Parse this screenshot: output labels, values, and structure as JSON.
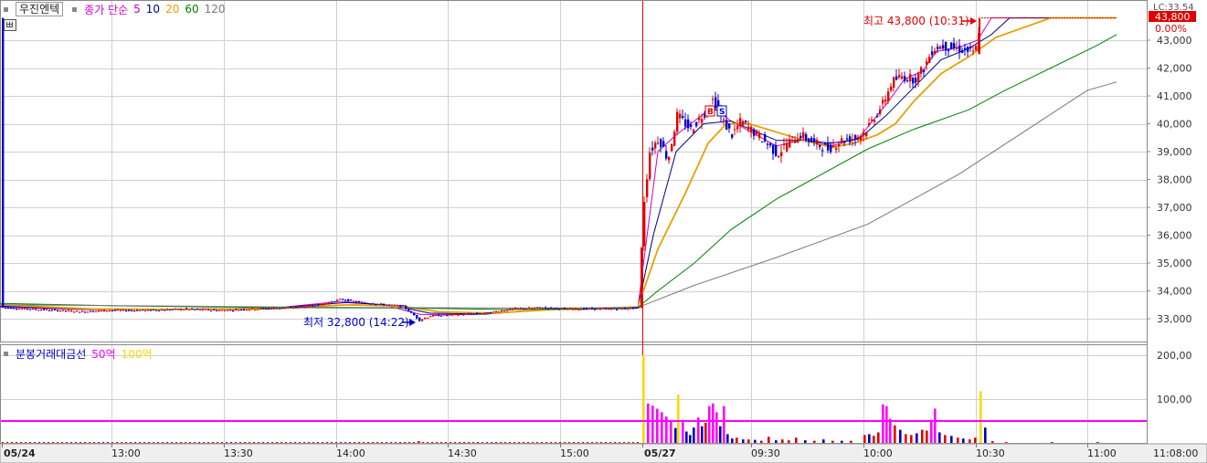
{
  "legend": {
    "stock_name": "우진엔텍",
    "ma_label": "종가 단순",
    "ma_periods": [
      {
        "label": "5",
        "color": "#cc00cc"
      },
      {
        "label": "10",
        "color": "#000080"
      },
      {
        "label": "20",
        "color": "#e8a000"
      },
      {
        "label": "60",
        "color": "#008000"
      },
      {
        "label": "120",
        "color": "#777777"
      }
    ]
  },
  "volume_legend": {
    "title": "분봉거래대금선",
    "line1": {
      "label": "50억",
      "color": "#ff00ff"
    },
    "line2": {
      "label": "100억",
      "color": "#ffd700"
    }
  },
  "price_panel": {
    "top_right_label": "LC:33.54",
    "last_price_badge": "43,800",
    "change_pct": "0.00%",
    "high_annotation": "최고 43,800 (10:31)",
    "low_annotation": "최저 32,800 (14:22)"
  },
  "time_axis": {
    "labels": [
      "05/24",
      "13:00",
      "13:30",
      "14:00",
      "14:30",
      "15:00",
      "05/27",
      "09:30",
      "10:00",
      "10:30",
      "11:00"
    ],
    "clock": "11:08:00"
  },
  "colors": {
    "up": "#e00000",
    "down": "#0000c8",
    "day_divider": "#e00000",
    "grid": "#d0d0d0",
    "badge_bg": "#e00000"
  },
  "chart_data": [
    {
      "type": "candlestick",
      "title": "우진엔텍",
      "ylim": [
        32500,
        44000
      ],
      "y_ticks": [
        "33,000",
        "34,000",
        "35,000",
        "36,000",
        "37,000",
        "38,000",
        "39,000",
        "40,000",
        "41,000",
        "42,000",
        "43,000"
      ],
      "x_labels": [
        "05/24",
        "13:00",
        "13:30",
        "14:00",
        "14:30",
        "15:00",
        "05/27",
        "09:30",
        "10:00",
        "10:30",
        "11:00"
      ],
      "high": {
        "value": 43800,
        "time": "10:31"
      },
      "low": {
        "value": 32800,
        "time": "14:22"
      },
      "price_path": [
        [
          0,
          33400
        ],
        [
          30,
          33350
        ],
        [
          60,
          33300
        ],
        [
          90,
          33250
        ],
        [
          120,
          33300
        ],
        [
          160,
          33300
        ],
        [
          200,
          33350
        ],
        [
          240,
          33300
        ],
        [
          280,
          33350
        ],
        [
          320,
          33400
        ],
        [
          350,
          33500
        ],
        [
          372,
          33700
        ],
        [
          390,
          33600
        ],
        [
          420,
          33500
        ],
        [
          440,
          33450
        ],
        [
          458,
          32950
        ],
        [
          470,
          33100
        ],
        [
          500,
          33150
        ],
        [
          530,
          33200
        ],
        [
          560,
          33350
        ],
        [
          590,
          33400
        ],
        [
          620,
          33350
        ],
        [
          650,
          33350
        ],
        [
          680,
          33350
        ],
        [
          698,
          33400
        ],
        [
          703,
          37000
        ],
        [
          710,
          39000
        ],
        [
          720,
          39500
        ],
        [
          730,
          38700
        ],
        [
          740,
          40300
        ],
        [
          755,
          39800
        ],
        [
          770,
          40400
        ],
        [
          780,
          40900
        ],
        [
          790,
          40100
        ],
        [
          800,
          39600
        ],
        [
          810,
          40100
        ],
        [
          820,
          39800
        ],
        [
          835,
          39400
        ],
        [
          850,
          38900
        ],
        [
          860,
          39300
        ],
        [
          875,
          39600
        ],
        [
          890,
          39300
        ],
        [
          905,
          39100
        ],
        [
          920,
          39400
        ],
        [
          935,
          39500
        ],
        [
          945,
          39700
        ],
        [
          955,
          40200
        ],
        [
          965,
          40700
        ],
        [
          975,
          41500
        ],
        [
          985,
          41700
        ],
        [
          1000,
          41600
        ],
        [
          1010,
          42000
        ],
        [
          1020,
          42700
        ],
        [
          1030,
          42800
        ],
        [
          1045,
          42700
        ],
        [
          1060,
          42600
        ],
        [
          1066,
          42500
        ],
        [
          1072,
          43800
        ],
        [
          1100,
          43800
        ],
        [
          1150,
          43800
        ],
        [
          1222,
          43800
        ]
      ],
      "moving_averages": [
        {
          "name": "5",
          "color": "#cc00cc",
          "points": [
            [
              0,
              33420
            ],
            [
              100,
              33320
            ],
            [
              200,
              33340
            ],
            [
              300,
              33380
            ],
            [
              372,
              33620
            ],
            [
              420,
              33500
            ],
            [
              460,
              33150
            ],
            [
              520,
              33150
            ],
            [
              600,
              33350
            ],
            [
              698,
              33380
            ],
            [
              720,
              39000
            ],
            [
              740,
              39600
            ],
            [
              780,
              40600
            ],
            [
              800,
              40100
            ],
            [
              850,
              39200
            ],
            [
              880,
              39450
            ],
            [
              910,
              39200
            ],
            [
              940,
              39500
            ],
            [
              970,
              40700
            ],
            [
              990,
              41600
            ],
            [
              1010,
              41900
            ],
            [
              1025,
              42600
            ],
            [
              1050,
              42750
            ],
            [
              1070,
              43000
            ],
            [
              1085,
              43800
            ],
            [
              1222,
              43800
            ]
          ]
        },
        {
          "name": "10",
          "color": "#000080",
          "points": [
            [
              0,
              33450
            ],
            [
              100,
              33330
            ],
            [
              200,
              33340
            ],
            [
              300,
              33380
            ],
            [
              380,
              33580
            ],
            [
              430,
              33480
            ],
            [
              470,
              33200
            ],
            [
              530,
              33160
            ],
            [
              600,
              33330
            ],
            [
              698,
              33380
            ],
            [
              715,
              36000
            ],
            [
              740,
              39000
            ],
            [
              770,
              40000
            ],
            [
              800,
              40100
            ],
            [
              850,
              39400
            ],
            [
              880,
              39400
            ],
            [
              910,
              39300
            ],
            [
              940,
              39450
            ],
            [
              970,
              40300
            ],
            [
              1000,
              41300
            ],
            [
              1030,
              42300
            ],
            [
              1060,
              42700
            ],
            [
              1085,
              43200
            ],
            [
              1105,
              43800
            ],
            [
              1222,
              43800
            ]
          ]
        },
        {
          "name": "20",
          "color": "#e8a000",
          "points": [
            [
              0,
              33500
            ],
            [
              100,
              33350
            ],
            [
              200,
              33330
            ],
            [
              300,
              33360
            ],
            [
              380,
              33500
            ],
            [
              440,
              33450
            ],
            [
              480,
              33250
            ],
            [
              540,
              33200
            ],
            [
              600,
              33320
            ],
            [
              698,
              33420
            ],
            [
              720,
              35500
            ],
            [
              750,
              37500
            ],
            [
              775,
              39300
            ],
            [
              795,
              40000
            ],
            [
              820,
              40000
            ],
            [
              850,
              39700
            ],
            [
              880,
              39400
            ],
            [
              910,
              39150
            ],
            [
              935,
              39300
            ],
            [
              960,
              39600
            ],
            [
              980,
              40000
            ],
            [
              1000,
              40800
            ],
            [
              1030,
              41800
            ],
            [
              1060,
              42400
            ],
            [
              1090,
              43100
            ],
            [
              1120,
              43450
            ],
            [
              1150,
              43800
            ],
            [
              1222,
              43800
            ]
          ]
        },
        {
          "name": "60",
          "color": "#008000",
          "points": [
            [
              0,
              33550
            ],
            [
              150,
              33450
            ],
            [
              300,
              33400
            ],
            [
              450,
              33380
            ],
            [
              550,
              33330
            ],
            [
              650,
              33350
            ],
            [
              698,
              33400
            ],
            [
              720,
              34000
            ],
            [
              760,
              35000
            ],
            [
              800,
              36200
            ],
            [
              850,
              37300
            ],
            [
              900,
              38200
            ],
            [
              950,
              39100
            ],
            [
              1000,
              39800
            ],
            [
              1060,
              40500
            ],
            [
              1100,
              41200
            ],
            [
              1150,
              42000
            ],
            [
              1200,
              42800
            ],
            [
              1222,
              43200
            ]
          ]
        },
        {
          "name": "120",
          "color": "#777777",
          "points": [
            [
              0,
              33500
            ],
            [
              200,
              33450
            ],
            [
              400,
              33400
            ],
            [
              600,
              33380
            ],
            [
              698,
              33400
            ],
            [
              760,
              34200
            ],
            [
              850,
              35200
            ],
            [
              950,
              36400
            ],
            [
              1050,
              38200
            ],
            [
              1120,
              39700
            ],
            [
              1190,
              41200
            ],
            [
              1222,
              41500
            ]
          ]
        }
      ]
    },
    {
      "type": "bar",
      "title": "분봉거래대금선",
      "y_ticks": [
        "100,00",
        "200,00"
      ],
      "ylim": [
        0,
        200
      ],
      "reference_lines": [
        {
          "name": "50억",
          "value": 50
        }
      ],
      "bars_colors": {
        "up": "#e00000",
        "down": "#0000c8",
        "over_50": "#ff00ff",
        "over_100": "#ffd700"
      },
      "values": [
        [
          457,
          4,
          "up"
        ],
        [
          703,
          200,
          "over_100"
        ],
        [
          708,
          90,
          "over_50"
        ],
        [
          713,
          85,
          "over_50"
        ],
        [
          718,
          78,
          "over_50"
        ],
        [
          723,
          70,
          "over_50"
        ],
        [
          728,
          60,
          "over_50"
        ],
        [
          733,
          52,
          "over_50"
        ],
        [
          738,
          34,
          "down"
        ],
        [
          741,
          110,
          "over_100"
        ],
        [
          746,
          50,
          "over_50"
        ],
        [
          750,
          26,
          "down"
        ],
        [
          754,
          18,
          "down"
        ],
        [
          758,
          35,
          "down"
        ],
        [
          763,
          58,
          "over_50"
        ],
        [
          767,
          38,
          "down"
        ],
        [
          771,
          46,
          "up"
        ],
        [
          775,
          84,
          "over_50"
        ],
        [
          779,
          90,
          "over_50"
        ],
        [
          783,
          70,
          "over_50"
        ],
        [
          787,
          38,
          "down"
        ],
        [
          791,
          84,
          "over_50"
        ],
        [
          795,
          20,
          "down"
        ],
        [
          800,
          10,
          "down"
        ],
        [
          805,
          12,
          "up"
        ],
        [
          812,
          8,
          "down"
        ],
        [
          818,
          8,
          "up"
        ],
        [
          825,
          7,
          "down"
        ],
        [
          832,
          5,
          "up"
        ],
        [
          840,
          14,
          "up"
        ],
        [
          848,
          6,
          "down"
        ],
        [
          855,
          8,
          "up"
        ],
        [
          862,
          6,
          "up"
        ],
        [
          870,
          12,
          "up"
        ],
        [
          880,
          6,
          "down"
        ],
        [
          890,
          5,
          "up"
        ],
        [
          900,
          8,
          "down"
        ],
        [
          910,
          5,
          "up"
        ],
        [
          920,
          5,
          "down"
        ],
        [
          930,
          5,
          "up"
        ],
        [
          945,
          18,
          "up"
        ],
        [
          950,
          20,
          "down"
        ],
        [
          955,
          16,
          "up"
        ],
        [
          960,
          24,
          "up"
        ],
        [
          965,
          88,
          "over_50"
        ],
        [
          969,
          84,
          "over_50"
        ],
        [
          973,
          55,
          "over_50"
        ],
        [
          978,
          40,
          "up"
        ],
        [
          984,
          30,
          "down"
        ],
        [
          990,
          20,
          "up"
        ],
        [
          996,
          18,
          "up"
        ],
        [
          1002,
          22,
          "down"
        ],
        [
          1008,
          30,
          "up"
        ],
        [
          1013,
          28,
          "up"
        ],
        [
          1018,
          52,
          "over_50"
        ],
        [
          1022,
          78,
          "over_50"
        ],
        [
          1027,
          24,
          "down"
        ],
        [
          1033,
          18,
          "up"
        ],
        [
          1040,
          16,
          "down"
        ],
        [
          1047,
          12,
          "up"
        ],
        [
          1053,
          10,
          "down"
        ],
        [
          1060,
          8,
          "up"
        ],
        [
          1066,
          12,
          "up"
        ],
        [
          1072,
          118,
          "over_100"
        ],
        [
          1077,
          35,
          "down"
        ],
        [
          1085,
          4,
          "up"
        ],
        [
          1100,
          2,
          "up"
        ],
        [
          1150,
          2,
          "up"
        ],
        [
          1200,
          2,
          "up"
        ]
      ]
    }
  ]
}
